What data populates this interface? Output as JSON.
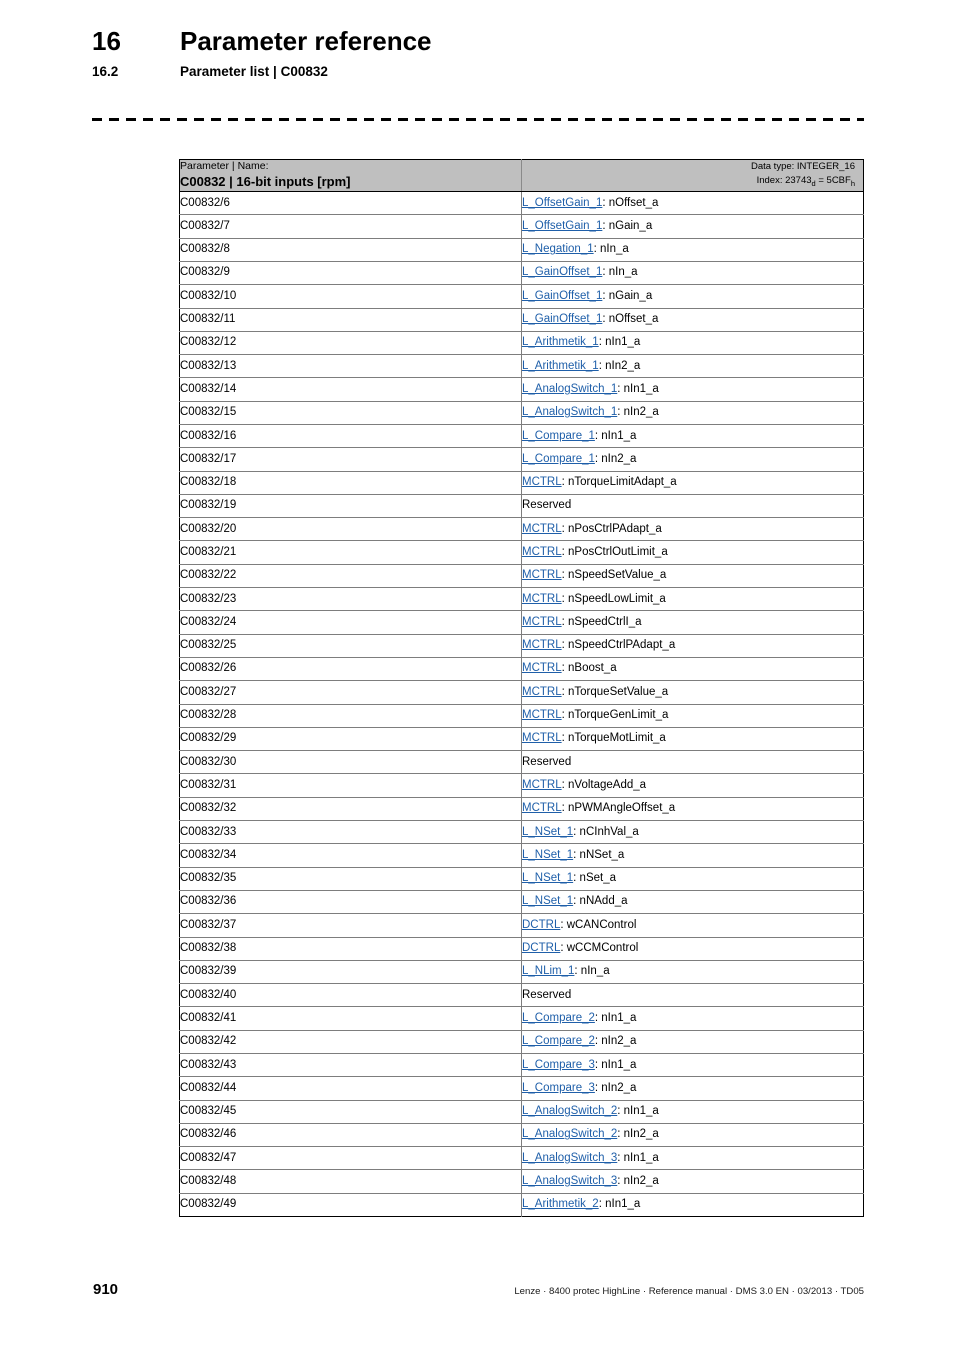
{
  "header": {
    "chapter_number": "16",
    "chapter_title": "Parameter reference",
    "section_number": "16.2",
    "section_title": "Parameter list | C00832"
  },
  "table": {
    "header": {
      "label": "Parameter | Name:",
      "title": "C00832 | 16-bit inputs [rpm]",
      "data_type": "Data type: INTEGER_16",
      "index_prefix": "Index: 23743",
      "index_sub_dec": "d",
      "index_mid": " = 5CBF",
      "index_sub_hex": "h"
    },
    "rows": [
      {
        "id": "C00832/6",
        "link": "L_OffsetGain_1",
        "port": ": nOffset_a"
      },
      {
        "id": "C00832/7",
        "link": "L_OffsetGain_1",
        "port": ": nGain_a"
      },
      {
        "id": "C00832/8",
        "link": "L_Negation_1",
        "port": ": nIn_a"
      },
      {
        "id": "C00832/9",
        "link": "L_GainOffset_1",
        "port": ": nIn_a"
      },
      {
        "id": "C00832/10",
        "link": "L_GainOffset_1",
        "port": ": nGain_a"
      },
      {
        "id": "C00832/11",
        "link": "L_GainOffset_1",
        "port": ": nOffset_a"
      },
      {
        "id": "C00832/12",
        "link": "L_Arithmetik_1",
        "port": ": nIn1_a"
      },
      {
        "id": "C00832/13",
        "link": "L_Arithmetik_1",
        "port": ": nIn2_a"
      },
      {
        "id": "C00832/14",
        "link": "L_AnalogSwitch_1",
        "port": ": nIn1_a"
      },
      {
        "id": "C00832/15",
        "link": "L_AnalogSwitch_1",
        "port": ": nIn2_a"
      },
      {
        "id": "C00832/16",
        "link": "L_Compare_1",
        "port": ": nIn1_a"
      },
      {
        "id": "C00832/17",
        "link": "L_Compare_1",
        "port": ": nIn2_a"
      },
      {
        "id": "C00832/18",
        "link": "MCTRL",
        "port": ": nTorqueLimitAdapt_a"
      },
      {
        "id": "C00832/19",
        "link": "",
        "port": "Reserved"
      },
      {
        "id": "C00832/20",
        "link": "MCTRL",
        "port": ": nPosCtrlPAdapt_a"
      },
      {
        "id": "C00832/21",
        "link": "MCTRL",
        "port": ": nPosCtrlOutLimit_a"
      },
      {
        "id": "C00832/22",
        "link": "MCTRL",
        "port": ": nSpeedSetValue_a"
      },
      {
        "id": "C00832/23",
        "link": "MCTRL",
        "port": ": nSpeedLowLimit_a"
      },
      {
        "id": "C00832/24",
        "link": "MCTRL",
        "port": ": nSpeedCtrlI_a"
      },
      {
        "id": "C00832/25",
        "link": "MCTRL",
        "port": ": nSpeedCtrlPAdapt_a"
      },
      {
        "id": "C00832/26",
        "link": "MCTRL",
        "port": ": nBoost_a"
      },
      {
        "id": "C00832/27",
        "link": "MCTRL",
        "port": ": nTorqueSetValue_a"
      },
      {
        "id": "C00832/28",
        "link": "MCTRL",
        "port": ": nTorqueGenLimit_a"
      },
      {
        "id": "C00832/29",
        "link": "MCTRL",
        "port": ": nTorqueMotLimit_a"
      },
      {
        "id": "C00832/30",
        "link": "",
        "port": "Reserved"
      },
      {
        "id": "C00832/31",
        "link": "MCTRL",
        "port": ": nVoltageAdd_a"
      },
      {
        "id": "C00832/32",
        "link": "MCTRL",
        "port": ": nPWMAngleOffset_a"
      },
      {
        "id": "C00832/33",
        "link": "L_NSet_1",
        "port": ": nCInhVal_a"
      },
      {
        "id": "C00832/34",
        "link": "L_NSet_1",
        "port": ": nNSet_a"
      },
      {
        "id": "C00832/35",
        "link": "L_NSet_1",
        "port": ": nSet_a"
      },
      {
        "id": "C00832/36",
        "link": "L_NSet_1",
        "port": ": nNAdd_a"
      },
      {
        "id": "C00832/37",
        "link": "DCTRL",
        "port": ": wCANControl"
      },
      {
        "id": "C00832/38",
        "link": "DCTRL",
        "port": ": wCCMControl"
      },
      {
        "id": "C00832/39",
        "link": "L_NLim_1",
        "port": ": nIn_a"
      },
      {
        "id": "C00832/40",
        "link": "",
        "port": "Reserved"
      },
      {
        "id": "C00832/41",
        "link": "L_Compare_2",
        "port": ": nIn1_a"
      },
      {
        "id": "C00832/42",
        "link": "L_Compare_2",
        "port": ": nIn2_a"
      },
      {
        "id": "C00832/43",
        "link": "L_Compare_3",
        "port": ": nIn1_a"
      },
      {
        "id": "C00832/44",
        "link": "L_Compare_3",
        "port": ": nIn2_a"
      },
      {
        "id": "C00832/45",
        "link": "L_AnalogSwitch_2",
        "port": ": nIn1_a"
      },
      {
        "id": "C00832/46",
        "link": "L_AnalogSwitch_2",
        "port": ": nIn2_a"
      },
      {
        "id": "C00832/47",
        "link": "L_AnalogSwitch_3",
        "port": ": nIn1_a"
      },
      {
        "id": "C00832/48",
        "link": "L_AnalogSwitch_3",
        "port": ": nIn2_a"
      },
      {
        "id": "C00832/49",
        "link": "L_Arithmetik_2",
        "port": ": nIn1_a"
      }
    ]
  },
  "footer": {
    "page_number": "910",
    "note": "Lenze · 8400 protec HighLine · Reference manual · DMS 3.0 EN · 03/2013 · TD05"
  }
}
